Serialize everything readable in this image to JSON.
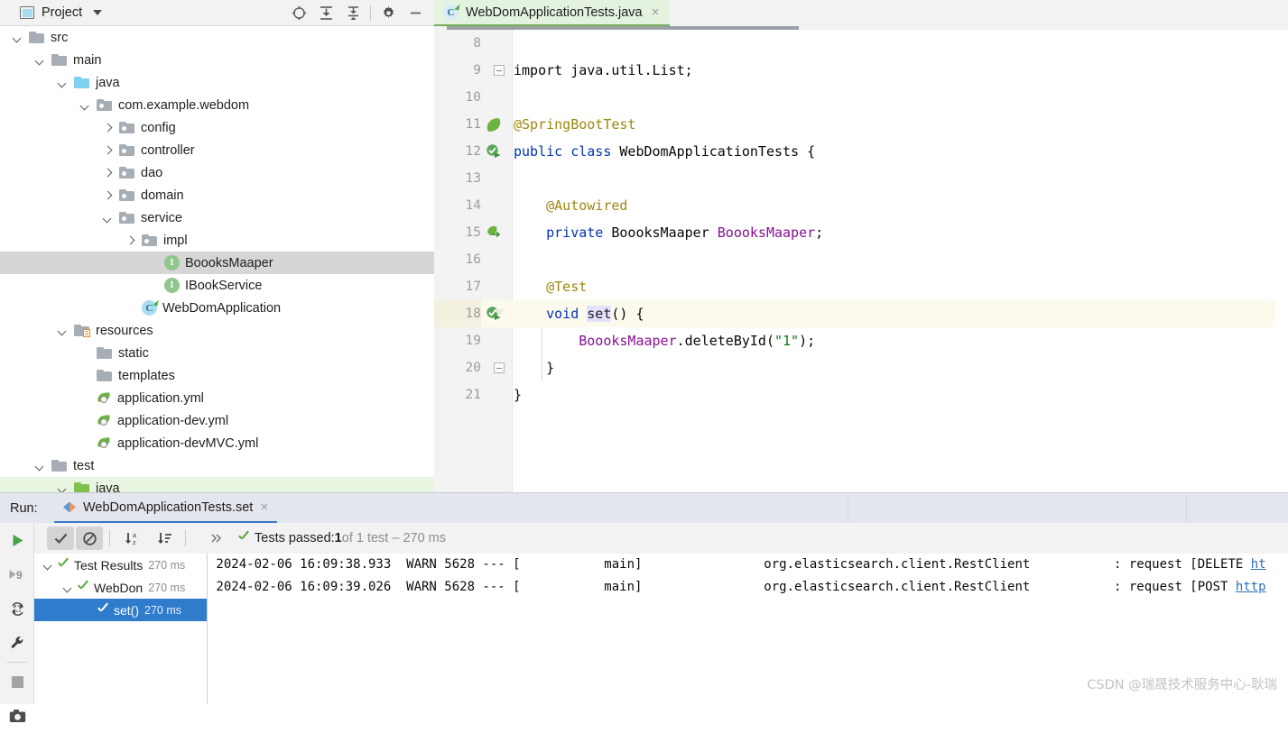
{
  "project_panel": {
    "title": "Project",
    "icon": "project-window-icon",
    "tools": [
      {
        "name": "locate-icon",
        "label": "Select Opened File"
      },
      {
        "name": "expand-all-icon",
        "label": "Expand All"
      },
      {
        "name": "collapse-all-icon",
        "label": "Collapse All"
      },
      {
        "name": "settings-gear-icon",
        "label": "Settings"
      },
      {
        "name": "hide-icon",
        "label": "Hide"
      }
    ],
    "tree": [
      {
        "label": "src",
        "indent": 0,
        "arrow": "down",
        "icon": "folder",
        "state": "normal"
      },
      {
        "label": "main",
        "indent": 1,
        "arrow": "down",
        "icon": "folder",
        "state": "normal"
      },
      {
        "label": "java",
        "indent": 2,
        "arrow": "down",
        "icon": "folder-blue",
        "state": "normal"
      },
      {
        "label": "com.example.webdom",
        "indent": 3,
        "arrow": "down",
        "icon": "package",
        "state": "normal"
      },
      {
        "label": "config",
        "indent": 4,
        "arrow": "right",
        "icon": "package",
        "state": "normal"
      },
      {
        "label": "controller",
        "indent": 4,
        "arrow": "right",
        "icon": "package",
        "state": "normal"
      },
      {
        "label": "dao",
        "indent": 4,
        "arrow": "right",
        "icon": "package",
        "state": "normal"
      },
      {
        "label": "domain",
        "indent": 4,
        "arrow": "right",
        "icon": "package",
        "state": "normal"
      },
      {
        "label": "service",
        "indent": 4,
        "arrow": "down",
        "icon": "package",
        "state": "normal"
      },
      {
        "label": "impl",
        "indent": 5,
        "arrow": "right",
        "icon": "package",
        "state": "normal"
      },
      {
        "label": "BoooksMaaper",
        "indent": 6,
        "arrow": "none",
        "icon": "interface",
        "state": "selected"
      },
      {
        "label": "IBookService",
        "indent": 6,
        "arrow": "none",
        "icon": "interface",
        "state": "normal"
      },
      {
        "label": "WebDomApplication",
        "indent": 5,
        "arrow": "none",
        "icon": "java-class-run",
        "state": "normal"
      },
      {
        "label": "resources",
        "indent": 2,
        "arrow": "down",
        "icon": "folder-resources",
        "state": "normal"
      },
      {
        "label": "static",
        "indent": 3,
        "arrow": "none",
        "icon": "folder",
        "state": "normal"
      },
      {
        "label": "templates",
        "indent": 3,
        "arrow": "none",
        "icon": "folder",
        "state": "normal"
      },
      {
        "label": "application.yml",
        "indent": 3,
        "arrow": "none",
        "icon": "yml",
        "state": "normal"
      },
      {
        "label": "application-dev.yml",
        "indent": 3,
        "arrow": "none",
        "icon": "yml",
        "state": "normal"
      },
      {
        "label": "application-devMVC.yml",
        "indent": 3,
        "arrow": "none",
        "icon": "yml",
        "state": "normal"
      },
      {
        "label": "test",
        "indent": 1,
        "arrow": "down",
        "icon": "folder",
        "state": "normal"
      },
      {
        "label": "java",
        "indent": 2,
        "arrow": "down",
        "icon": "folder-green",
        "state": "green-selected"
      }
    ]
  },
  "editor": {
    "tab": {
      "label": "WebDomApplicationTests.java",
      "icon": "java-class-run-icon",
      "close": "×"
    },
    "lines": [
      {
        "num": "8",
        "gutter": "",
        "fold": "",
        "hl": false,
        "tokens": []
      },
      {
        "num": "9",
        "gutter": "",
        "fold": "minus",
        "hl": false,
        "tokens": [
          {
            "t": "import java.util.List;",
            "c": "plain"
          }
        ]
      },
      {
        "num": "10",
        "gutter": "",
        "fold": "",
        "hl": false,
        "tokens": []
      },
      {
        "num": "11",
        "gutter": "spring",
        "fold": "",
        "hl": false,
        "tokens": [
          {
            "t": "@SpringBootTest",
            "c": "anno"
          }
        ]
      },
      {
        "num": "12",
        "gutter": "runtest",
        "fold": "",
        "hl": false,
        "tokens": [
          {
            "t": "public ",
            "c": "kw"
          },
          {
            "t": "class ",
            "c": "kw"
          },
          {
            "t": "WebDomApplicationTests {",
            "c": "plain"
          }
        ]
      },
      {
        "num": "13",
        "gutter": "",
        "fold": "",
        "hl": false,
        "tokens": []
      },
      {
        "num": "14",
        "gutter": "",
        "fold": "",
        "hl": false,
        "tokens": [
          {
            "t": "    @Autowired",
            "c": "anno"
          }
        ]
      },
      {
        "num": "15",
        "gutter": "bean",
        "fold": "",
        "hl": false,
        "tokens": [
          {
            "t": "    private ",
            "c": "kw"
          },
          {
            "t": "BoooksMaaper ",
            "c": "plain"
          },
          {
            "t": "BoooksMaaper",
            "c": "fld"
          },
          {
            "t": ";",
            "c": "plain"
          }
        ]
      },
      {
        "num": "16",
        "gutter": "",
        "fold": "",
        "hl": false,
        "tokens": []
      },
      {
        "num": "17",
        "gutter": "",
        "fold": "",
        "hl": false,
        "tokens": [
          {
            "t": "    @Test",
            "c": "anno"
          }
        ]
      },
      {
        "num": "18",
        "gutter": "runtest",
        "fold": "arrowdown",
        "hl": true,
        "tokens": [
          {
            "t": "    void ",
            "c": "kw"
          },
          {
            "t": "set",
            "c": "sel-tok"
          },
          {
            "t": "() {",
            "c": "plain"
          }
        ]
      },
      {
        "num": "19",
        "gutter": "",
        "fold": "",
        "hl": false,
        "tokens": [
          {
            "t": "        ",
            "c": "plain"
          },
          {
            "t": "BoooksMaaper",
            "c": "fld"
          },
          {
            "t": ".deleteById(",
            "c": "plain"
          },
          {
            "t": "\"1\"",
            "c": "str"
          },
          {
            "t": ");",
            "c": "plain"
          }
        ]
      },
      {
        "num": "20",
        "gutter": "",
        "fold": "minus",
        "hl": false,
        "tokens": [
          {
            "t": "    }",
            "c": "plain"
          }
        ]
      },
      {
        "num": "21",
        "gutter": "",
        "fold": "",
        "hl": false,
        "tokens": [
          {
            "t": "}",
            "c": "plain"
          }
        ]
      }
    ]
  },
  "run_panel": {
    "label": "Run:",
    "tab": {
      "label": "WebDomApplicationTests.set",
      "icon": "run-config-icon",
      "close": "×"
    },
    "toolbar": {
      "run_icon": "play-icon",
      "buttons": [
        {
          "name": "show-passed-toggle",
          "icon": "check-icon",
          "active": true
        },
        {
          "name": "hide-ignored-toggle",
          "icon": "no-entry-icon",
          "active": true
        },
        {
          "name": "sort-alphabetically-button",
          "icon": "sort-az-icon",
          "active": false
        },
        {
          "name": "sort-by-duration-button",
          "icon": "sort-duration-icon",
          "active": false
        },
        {
          "name": "expand-more-button",
          "icon": "chevron-double-right-icon",
          "active": false
        }
      ]
    },
    "status": {
      "prefix": "Tests passed: ",
      "count": "1",
      "suffix": " of 1 test – 270 ms"
    },
    "rail": [
      {
        "name": "rerun-button",
        "icon": "play-icon"
      },
      {
        "name": "rerun-failed-button",
        "icon": "rerun-9-icon"
      },
      {
        "name": "toggle-auto-test-button",
        "icon": "auto-test-icon"
      },
      {
        "name": "settings-wrench-button",
        "icon": "wrench-icon"
      },
      {
        "name": "stop-button",
        "icon": "stop-square-icon"
      },
      {
        "name": "export-button",
        "icon": "camera-icon"
      }
    ],
    "tests": [
      {
        "label": "Test Results",
        "time": "270 ms",
        "indent": 0,
        "arrow": "down",
        "selected": false
      },
      {
        "label": "WebDon",
        "time": "270 ms",
        "indent": 1,
        "arrow": "down",
        "selected": false
      },
      {
        "label": "set()",
        "time": "270 ms",
        "indent": 2,
        "arrow": "none",
        "selected": true
      }
    ],
    "console": [
      {
        "timestamp": "2024-02-06 16:09:38.933",
        "level": "WARN",
        "pid": "5628",
        "sep": "---",
        "thread": "[           main]",
        "logger": "org.elasticsearch.client.RestClient",
        "colon": ":",
        "message": "request [DELETE ",
        "link": "ht"
      },
      {
        "timestamp": "2024-02-06 16:09:39.026",
        "level": "WARN",
        "pid": "5628",
        "sep": "---",
        "thread": "[           main]",
        "logger": "org.elasticsearch.client.RestClient",
        "colon": ":",
        "message": "request [POST ",
        "link": "http"
      }
    ]
  },
  "watermark": "CSDN @瑞晟技术服务中心-耿瑞",
  "colors": {
    "accent_blue": "#2f7ccd",
    "tab_green": "#e4f2e0",
    "tab_underline": "#79b05c",
    "selected_row": "#d6d6d6",
    "highlight_line": "#fcfaec",
    "keyword": "#0033b3",
    "annotation": "#9e880d",
    "field": "#871094",
    "string": "#067d17",
    "link": "#2f6fbf"
  }
}
